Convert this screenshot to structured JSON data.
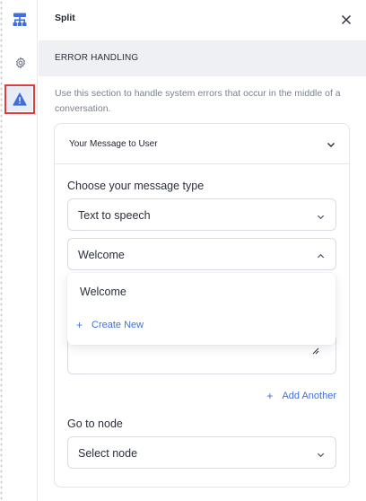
{
  "rail": {
    "items": [
      {
        "icon": "flow-icon"
      },
      {
        "icon": "gear-icon"
      },
      {
        "icon": "warning-icon",
        "active": true
      }
    ]
  },
  "header": {
    "title": "Split"
  },
  "section": {
    "title": "ERROR HANDLING",
    "description": "Use this section to handle system errors that occur in the middle of a conversation."
  },
  "card": {
    "title": "Your Message to User",
    "message_type_label": "Choose your message type",
    "message_type_value": "Text to speech",
    "message_value": "Welcome",
    "dropdown": {
      "options": [
        "Welcome"
      ],
      "create_new": "Create New"
    },
    "add_another": "Add Another",
    "go_to_node_label": "Go to node",
    "go_to_node_value": "Select node"
  },
  "colors": {
    "accent": "#3f6fd8",
    "highlight_border": "#e23b3b",
    "section_bg": "#eef0f3"
  }
}
